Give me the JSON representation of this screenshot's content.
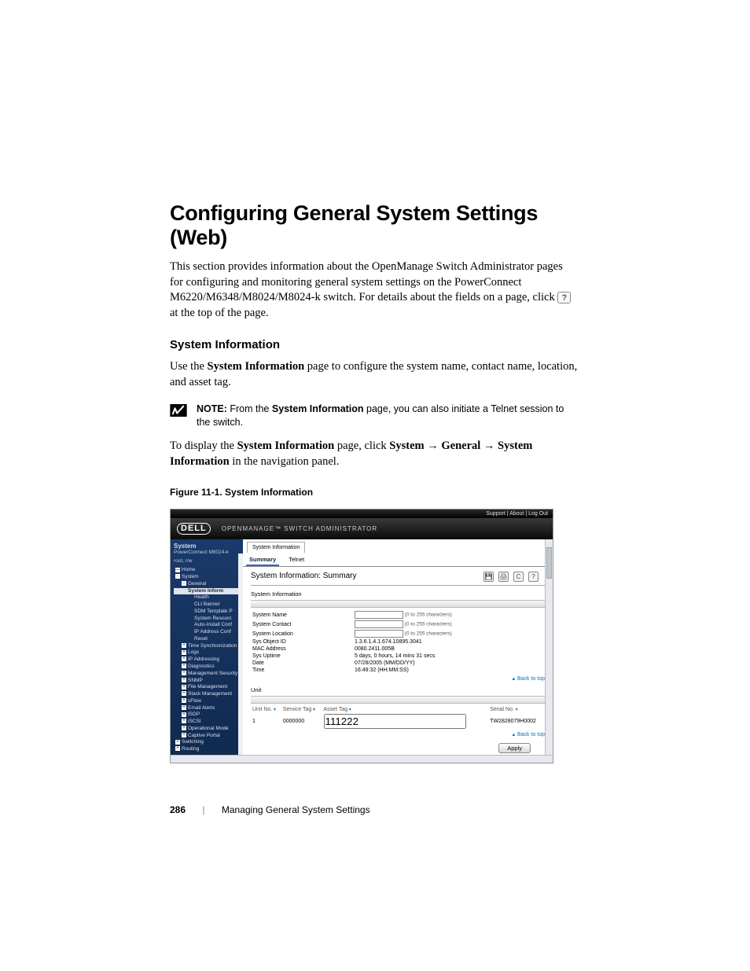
{
  "heading": "Configuring General System Settings (Web)",
  "intro_pre": "This section provides information about the OpenManage Switch Administrator pages for configuring and monitoring general system settings on the PowerConnect M6220/M6348/M8024/M8024-k switch. For details about the fields on a page, click",
  "intro_post": "at the top of the page.",
  "sub_heading": "System Information",
  "sysinfo_para_pre": "Use the ",
  "sysinfo_para_bold": "System Information",
  "sysinfo_para_post": " page to configure the system name, contact name, location, and asset tag.",
  "note_label": "NOTE:",
  "note_text_pre": " From the ",
  "note_text_bold": "System Information",
  "note_text_post": " page, you can also initiate a Telnet session to the switch.",
  "display_pre": "To display the ",
  "display_b1": "System Information",
  "display_mid1": " page, click ",
  "display_b2": "System",
  "display_b3": "General",
  "display_b4": "System Information",
  "display_post": " in the navigation panel.",
  "fig_caption": "Figure 11-1.    System Information",
  "shot": {
    "top_links": "Support  |  About  |  Log Out",
    "brand": "DELL",
    "product": "OPENMANAGE™ SWITCH ADMINISTRATOR",
    "left_header": "System",
    "left_sub": "PowerConnect M8024-k",
    "left_user": "root, r/w",
    "nav": [
      {
        "lvl": 1,
        "box": "—",
        "label": "Home"
      },
      {
        "lvl": 1,
        "box": "-",
        "label": "System"
      },
      {
        "lvl": 2,
        "box": "-",
        "label": "General"
      },
      {
        "lvl": 3,
        "selected": true,
        "label": "System Inform"
      },
      {
        "lvl": 4,
        "label": "Health"
      },
      {
        "lvl": 4,
        "label": "CLI Banner"
      },
      {
        "lvl": 4,
        "label": "SDM Template P"
      },
      {
        "lvl": 4,
        "label": "System Resourc"
      },
      {
        "lvl": 4,
        "label": "Auto-Install Conf"
      },
      {
        "lvl": 4,
        "label": "IP Address Conf"
      },
      {
        "lvl": 4,
        "label": "Reset"
      },
      {
        "lvl": 2,
        "box": "+",
        "label": "Time Synchronization"
      },
      {
        "lvl": 2,
        "box": "+",
        "label": "Logs"
      },
      {
        "lvl": 2,
        "box": "+",
        "label": "IP Addressing"
      },
      {
        "lvl": 2,
        "box": "+",
        "label": "Diagnostics"
      },
      {
        "lvl": 2,
        "box": "+",
        "label": "Management Security"
      },
      {
        "lvl": 2,
        "box": "+",
        "label": "SNMP"
      },
      {
        "lvl": 2,
        "box": "+",
        "label": "File Management"
      },
      {
        "lvl": 2,
        "box": "+",
        "label": "Stack Management"
      },
      {
        "lvl": 2,
        "box": "+",
        "label": "sFlow"
      },
      {
        "lvl": 2,
        "box": "+",
        "label": "Email Alerts"
      },
      {
        "lvl": 2,
        "box": "+",
        "label": "ISDP"
      },
      {
        "lvl": 2,
        "box": "+",
        "label": "iSCSI"
      },
      {
        "lvl": 2,
        "box": "+",
        "label": "Operational Mode"
      },
      {
        "lvl": 2,
        "box": "+",
        "label": "Captive Portal"
      },
      {
        "lvl": 1,
        "box": "+",
        "label": "Switching"
      },
      {
        "lvl": 1,
        "box": "+",
        "label": "Routing"
      }
    ],
    "crumb": "System Information",
    "tabs": {
      "summary": "Summary",
      "telnet": "Telnet"
    },
    "page_title": "System Information: Summary",
    "section_title": "System Information",
    "rows": [
      {
        "label": "System Name",
        "input": "",
        "hint": "(0 to 255 characters)"
      },
      {
        "label": "System Contact",
        "input": "",
        "hint": "(0 to 255 characters)"
      },
      {
        "label": "System Location",
        "input": "",
        "hint": "(0 to 255 characters)"
      },
      {
        "label": "Sys Object ID",
        "value": "1.3.6.1.4.1.674.10895.3041"
      },
      {
        "label": "MAC Address",
        "value": "0080.2411.005B"
      },
      {
        "label": "Sys Uptime",
        "value": "5 days, 0 hours, 14 mins 31 secs"
      },
      {
        "label": "Date",
        "value": "07/28/2005  (MM/DD/YY)"
      },
      {
        "label": "Time",
        "value": "16:49:32  (HH:MM:SS)"
      }
    ],
    "unit_section": "Unit",
    "unit_headers": [
      "Unit No.",
      "Service Tag",
      "Asset Tag",
      "Serial No."
    ],
    "unit_row": {
      "unit": "1",
      "service": "0000000",
      "asset": "111222",
      "serial": "TW2828079H0002"
    },
    "back_to_top": "Back to top",
    "apply": "Apply"
  },
  "footer": {
    "page": "286",
    "chapter": "Managing General System Settings"
  }
}
